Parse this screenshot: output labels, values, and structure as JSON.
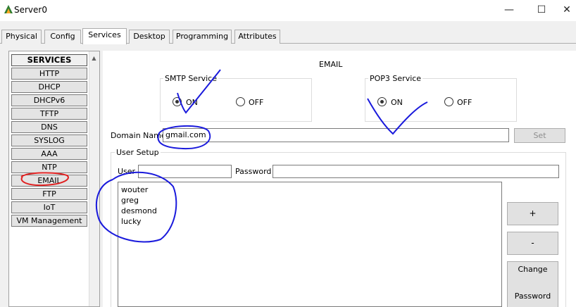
{
  "window": {
    "title": "Server0",
    "minimize_glyph": "—",
    "maximize_glyph": "☐",
    "close_glyph": "✕"
  },
  "tabs": [
    {
      "label": "Physical"
    },
    {
      "label": "Config"
    },
    {
      "label": "Services",
      "active": true
    },
    {
      "label": "Desktop"
    },
    {
      "label": "Programming"
    },
    {
      "label": "Attributes"
    }
  ],
  "sidebar": {
    "header": "SERVICES",
    "items": [
      "HTTP",
      "DHCP",
      "DHCPv6",
      "TFTP",
      "DNS",
      "SYSLOG",
      "AAA",
      "NTP",
      "EMAIL",
      "FTP",
      "IoT",
      "VM Management"
    ],
    "selected": "EMAIL"
  },
  "email": {
    "title": "EMAIL",
    "smtp": {
      "label": "SMTP Service",
      "on_label": "ON",
      "off_label": "OFF",
      "value": "ON"
    },
    "pop3": {
      "label": "POP3 Service",
      "on_label": "ON",
      "off_label": "OFF",
      "value": "ON"
    },
    "domain_label": "Domain Name:",
    "domain_value": "gmail.com",
    "set_label": "Set",
    "user_setup": {
      "label": "User Setup",
      "user_label": "User",
      "user_value": "",
      "password_label": "Password",
      "password_value": "",
      "users": [
        "wouter",
        "greg",
        "desmond",
        "lucky"
      ],
      "add_label": "+",
      "remove_label": "-",
      "change_label_line1": "Change",
      "change_label_line2": "Password"
    }
  },
  "colors": {
    "annotation_blue": "#1a1adc",
    "annotation_red": "#e02020",
    "window_bg": "#f0f0f0"
  }
}
